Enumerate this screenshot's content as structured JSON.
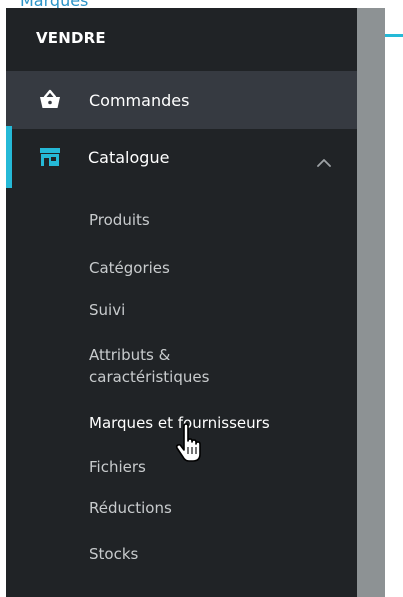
{
  "page_header": {
    "title": "Marques"
  },
  "sidebar": {
    "section_title": "VENDRE",
    "items": [
      {
        "label": "Commandes",
        "icon": "basket-icon"
      },
      {
        "label": "Catalogue",
        "icon": "store-icon",
        "active": true,
        "expanded": true
      }
    ],
    "submenu": [
      {
        "label": "Produits"
      },
      {
        "label": "Catégories"
      },
      {
        "label": "Suivi"
      },
      {
        "label": "Attributs &",
        "label2": "caractéristiques"
      },
      {
        "label": "Marques et fournisseurs",
        "hovered": true
      },
      {
        "label": "Fichiers"
      },
      {
        "label": "Réductions"
      },
      {
        "label": "Stocks"
      }
    ]
  },
  "colors": {
    "sidebar_bg": "#202326",
    "hover_bg": "#363a41",
    "accent": "#25b9d7",
    "link_blue": "#2b93c7"
  }
}
